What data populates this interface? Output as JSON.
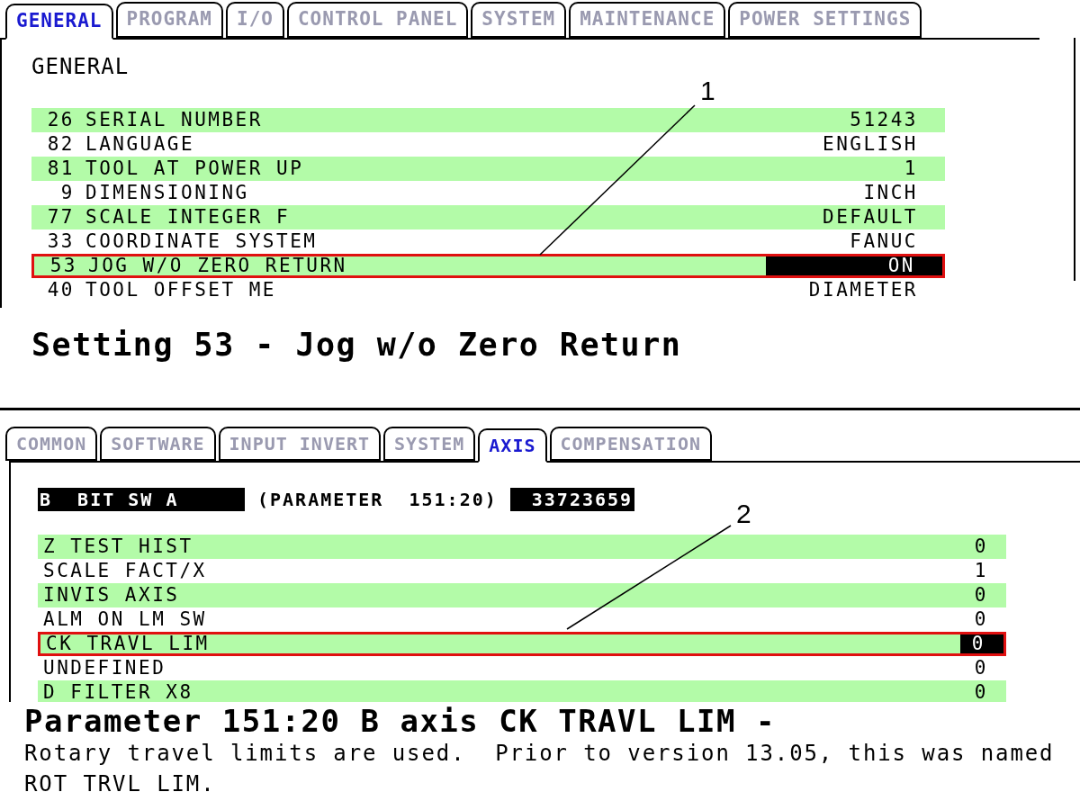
{
  "panels": [
    {
      "tabs": [
        {
          "label": "GENERAL",
          "selected": true
        },
        {
          "label": "PROGRAM",
          "selected": false
        },
        {
          "label": "I/O",
          "selected": false
        },
        {
          "label": "CONTROL PANEL",
          "selected": false
        },
        {
          "label": "SYSTEM",
          "selected": false
        },
        {
          "label": "MAINTENANCE",
          "selected": false
        },
        {
          "label": "POWER SETTINGS",
          "selected": false
        }
      ],
      "heading": "GENERAL",
      "rows": [
        {
          "number": "26",
          "label": "SERIAL NUMBER",
          "value": "51243",
          "highlighted": false
        },
        {
          "number": "82",
          "label": "LANGUAGE",
          "value": "ENGLISH",
          "highlighted": false
        },
        {
          "number": "81",
          "label": "TOOL AT POWER UP",
          "value": "1",
          "highlighted": false
        },
        {
          "number": "9",
          "label": "DIMENSIONING",
          "value": "INCH",
          "highlighted": false
        },
        {
          "number": "77",
          "label": "SCALE INTEGER F",
          "value": "DEFAULT",
          "highlighted": false
        },
        {
          "number": "33",
          "label": "COORDINATE SYSTEM",
          "value": "FANUC",
          "highlighted": false
        },
        {
          "number": "53",
          "label": "JOG W/O ZERO RETURN",
          "value": "ON",
          "highlighted": true
        },
        {
          "number": "40",
          "label": "TOOL OFFSET ME",
          "value": "DIAMETER",
          "highlighted": false
        }
      ],
      "callout": "1",
      "caption": "Setting 53 - Jog w/o Zero Return"
    },
    {
      "tabs": [
        {
          "label": "COMMON",
          "selected": false
        },
        {
          "label": "SOFTWARE",
          "selected": false
        },
        {
          "label": "INPUT INVERT",
          "selected": false
        },
        {
          "label": "SYSTEM",
          "selected": false
        },
        {
          "label": "AXIS",
          "selected": true
        },
        {
          "label": "COMPENSATION",
          "selected": false
        }
      ],
      "parameter": {
        "name": "B  BIT SW A",
        "reference": "(PARAMETER  151:20)",
        "value": "33723659"
      },
      "rows": [
        {
          "label": "Z TEST HIST",
          "value": "0",
          "highlighted": false
        },
        {
          "label": "SCALE FACT/X",
          "value": "1",
          "highlighted": false
        },
        {
          "label": "INVIS AXIS",
          "value": "0",
          "highlighted": false
        },
        {
          "label": "ALM ON LM SW",
          "value": "0",
          "highlighted": false
        },
        {
          "label": "CK TRAVL LIM",
          "value": "0",
          "highlighted": true
        },
        {
          "label": "UNDEFINED",
          "value": "0",
          "highlighted": false
        },
        {
          "label": "D FILTER X8",
          "value": "0",
          "highlighted": false
        }
      ],
      "callout": "2",
      "caption": "Parameter 151:20 B axis CK TRAVL LIM -",
      "description_lines": [
        "Rotary travel limits are used.  Prior to version 13.05, this was named",
        "ROT TRVL LIM."
      ]
    }
  ]
}
